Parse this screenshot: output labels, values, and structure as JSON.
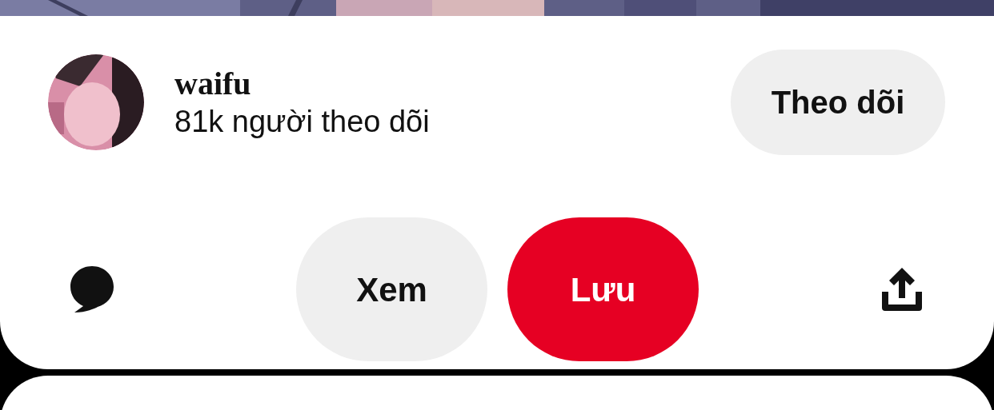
{
  "creator": {
    "name": "waifu",
    "followers": "81k người theo dõi"
  },
  "follow_button": {
    "label": "Theo dõi"
  },
  "actions": [
    {
      "label": "Xem",
      "kind": "secondary"
    },
    {
      "label": "Lưu",
      "kind": "primary"
    }
  ]
}
